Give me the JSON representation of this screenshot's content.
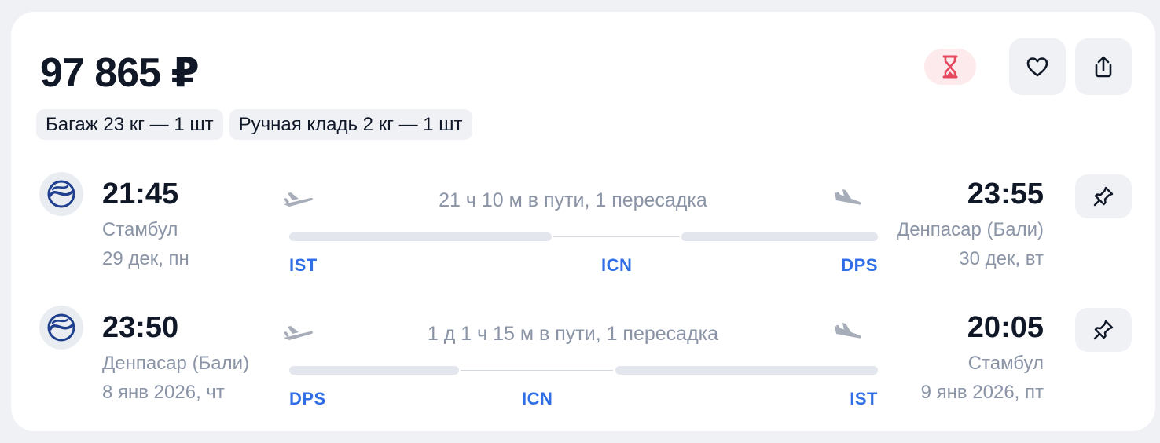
{
  "offer": {
    "price": "97 865 ₽",
    "baggage": [
      "Багаж 23 кг — 1 шт",
      "Ручная кладь 2 кг — 1 шт"
    ]
  },
  "actions": {
    "timer_icon": "hourglass-icon",
    "favorite_icon": "heart-icon",
    "share_icon": "share-icon"
  },
  "legs": [
    {
      "departure": {
        "time": "21:45",
        "city": "Стамбул",
        "date": "29 дек, пн"
      },
      "arrival": {
        "time": "23:55",
        "city": "Денпасар (Бали)",
        "date": "30 дек, вт"
      },
      "duration": "21 ч 10 м в пути, 1 пересадка",
      "codes": {
        "from": "IST",
        "via": "ICN",
        "to": "DPS"
      }
    },
    {
      "departure": {
        "time": "23:50",
        "city": "Денпасар (Бали)",
        "date": "8 янв 2026, чт"
      },
      "arrival": {
        "time": "20:05",
        "city": "Стамбул",
        "date": "9 янв 2026, пт"
      },
      "duration": "1 д 1 ч 15 м в пути, 1 пересадка",
      "codes": {
        "from": "DPS",
        "via": "ICN",
        "to": "IST"
      }
    }
  ],
  "colors": {
    "accent": "#2f6ee5",
    "timer_bg": "#fdeaec",
    "timer_icon": "#e5485f",
    "muted_text": "#8a94a6"
  }
}
